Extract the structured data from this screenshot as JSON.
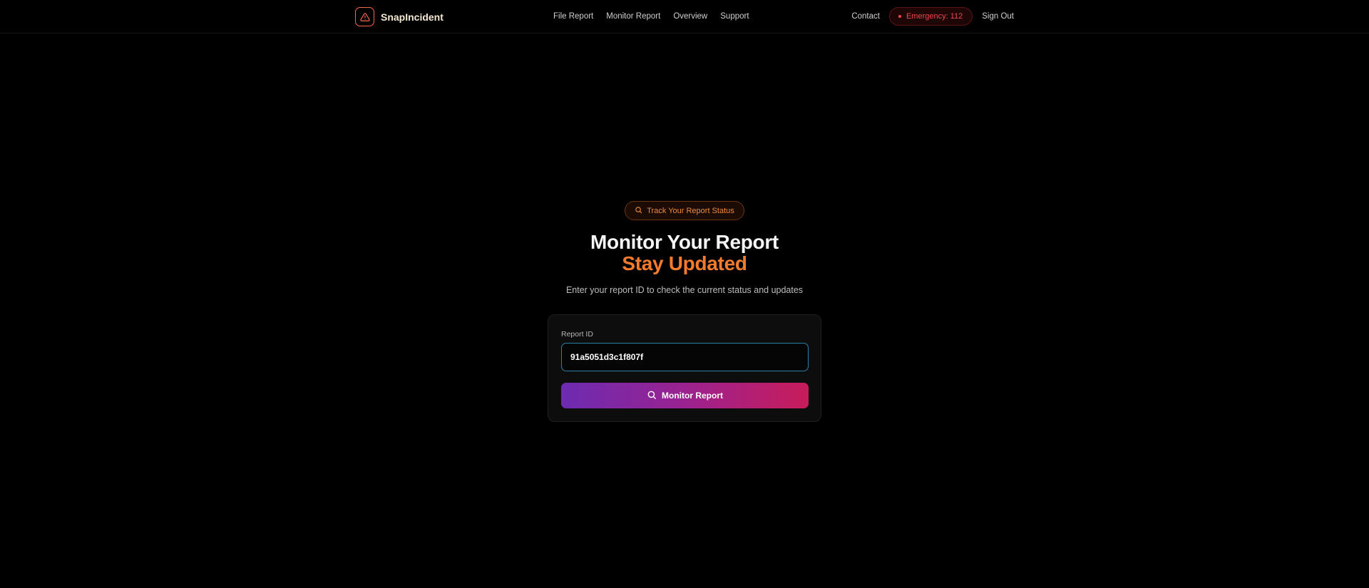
{
  "nav": {
    "brand": "SnapIncident",
    "links": [
      "File Report",
      "Monitor Report",
      "Overview",
      "Support"
    ],
    "contact": "Contact",
    "emergency": "Emergency: 112",
    "sign_out": "Sign Out"
  },
  "hero": {
    "badge": "Track Your Report Status",
    "title_line1": "Monitor Your Report",
    "title_line2": "Stay Updated",
    "subtitle": "Enter your report ID to check the current status and updates"
  },
  "form": {
    "label": "Report ID",
    "value": "91a5051d3c1f807f",
    "button_label": "Monitor Report"
  },
  "colors": {
    "accent": "#f27b2d",
    "emergency": "#f0464a",
    "brand_icon": "#f4674c",
    "input_focus": "#2a7fa3",
    "button_gradient_start": "#6c2bb1",
    "button_gradient_end": "#c81c5a"
  },
  "icons": {
    "brand": "warning-triangle-icon",
    "badge": "search-icon",
    "button": "search-icon"
  }
}
